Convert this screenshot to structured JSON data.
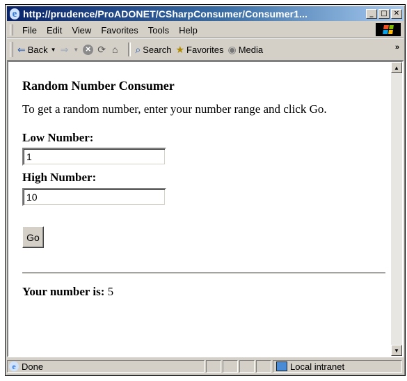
{
  "window": {
    "title": "http://prudence/ProADONET/CSharpConsumer/Consumer1...",
    "controls": {
      "minimize": "_",
      "maximize": "□",
      "close": "✕"
    }
  },
  "menu": {
    "items": [
      "File",
      "Edit",
      "View",
      "Favorites",
      "Tools",
      "Help"
    ]
  },
  "toolbar": {
    "back_label": "Back",
    "search_label": "Search",
    "favorites_label": "Favorites",
    "media_label": "Media",
    "overflow": "»"
  },
  "page": {
    "title": "Random Number Consumer",
    "intro": "To get a random number, enter your number range and click Go.",
    "low_label": "Low Number:",
    "low_value": "1",
    "high_label": "High Number:",
    "high_value": "10",
    "go_label": "Go",
    "result_label": "Your number is:",
    "result_value": "5"
  },
  "status": {
    "text": "Done",
    "zone": "Local intranet"
  },
  "icons": [
    "ie-icon",
    "windows-logo-icon",
    "back-arrow-icon",
    "forward-arrow-icon",
    "stop-icon",
    "refresh-icon",
    "home-icon",
    "search-icon",
    "favorites-icon",
    "media-icon",
    "intranet-icon"
  ]
}
